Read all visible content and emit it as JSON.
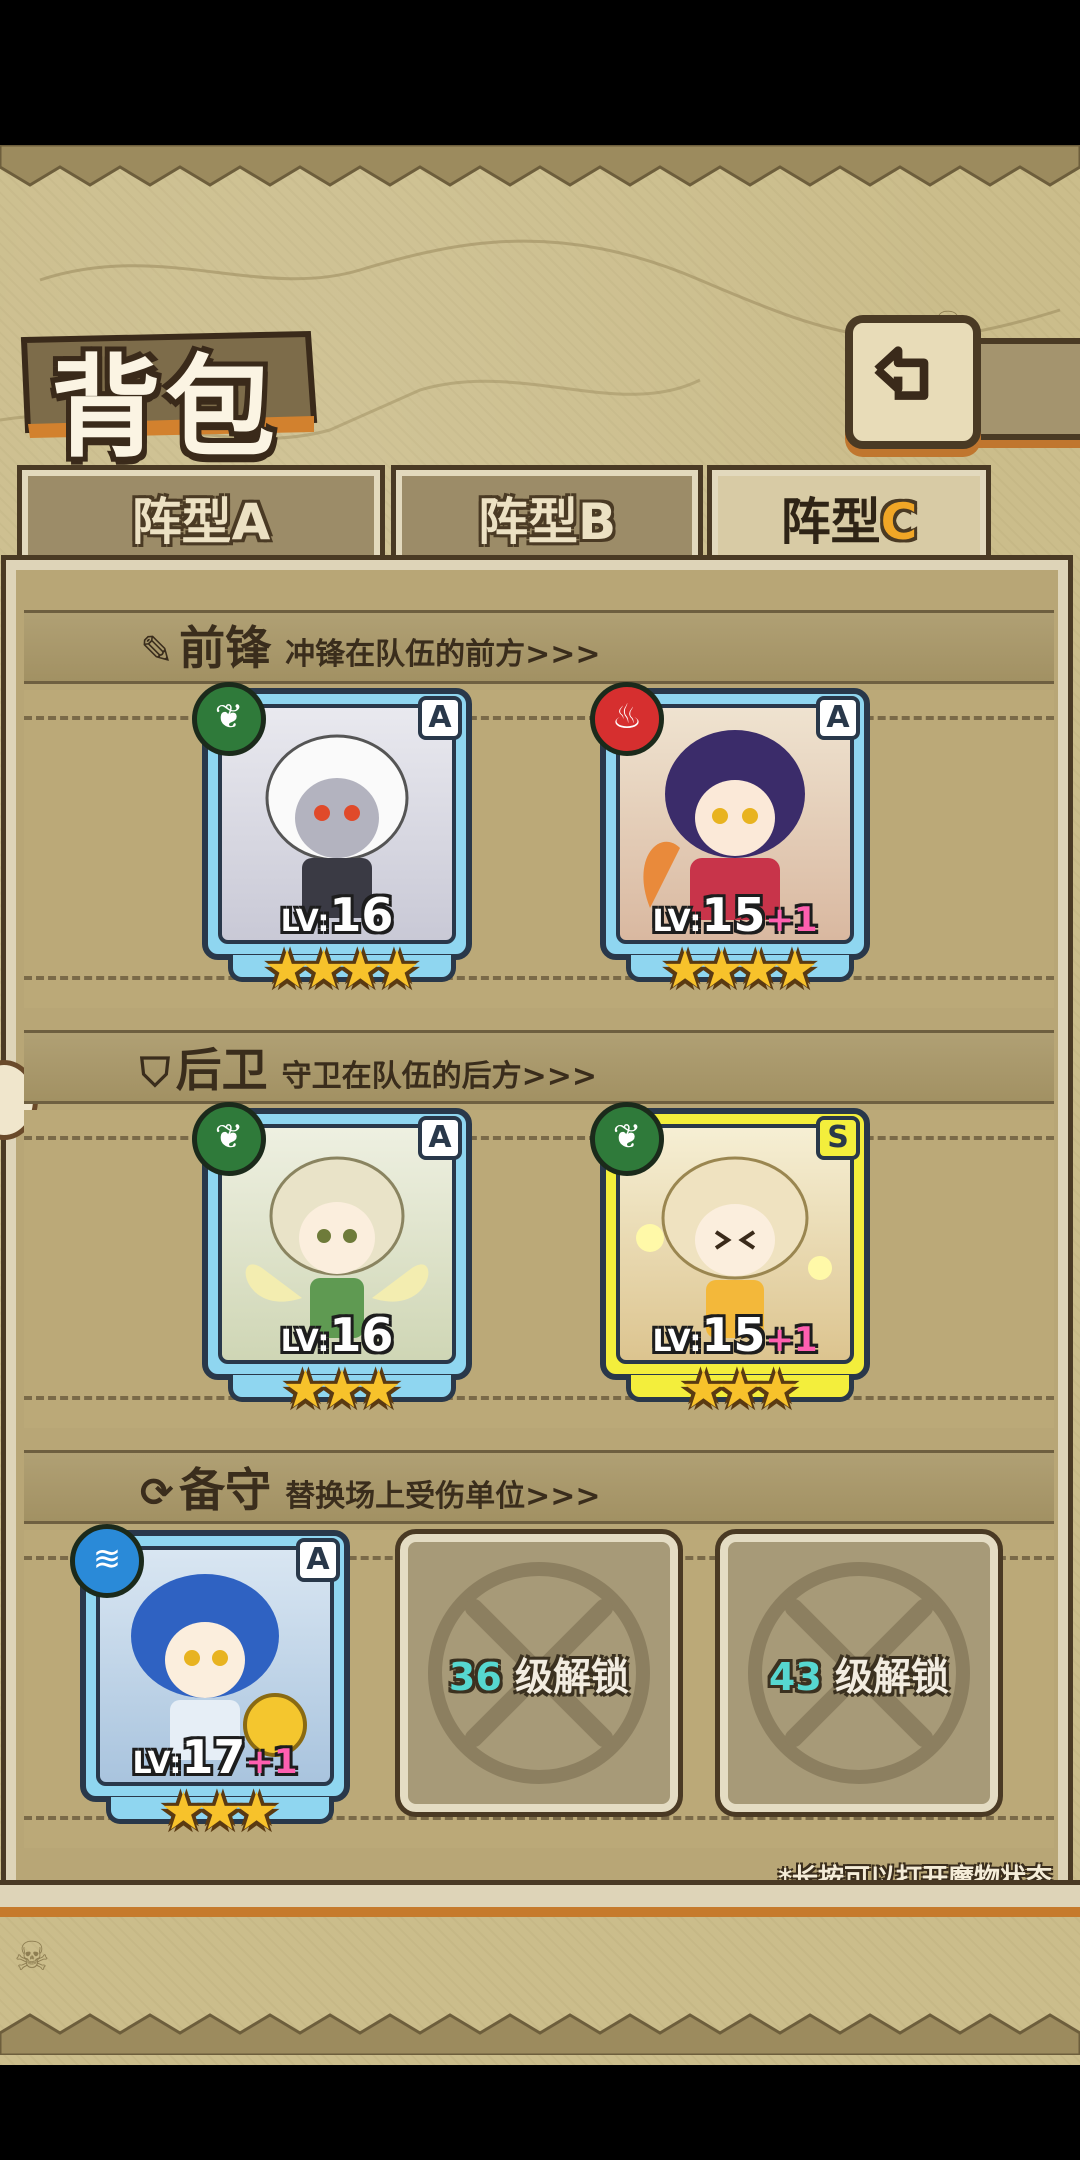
{
  "header": {
    "title": "背包"
  },
  "tabs": [
    {
      "label": "阵型",
      "suffix": "A",
      "active": false
    },
    {
      "label": "阵型",
      "suffix": "B",
      "active": false
    },
    {
      "label": "阵型",
      "suffix": "C",
      "active": true
    }
  ],
  "sections": {
    "front": {
      "title": "前锋",
      "desc": "冲锋在队伍的前方>>>",
      "icon": "sword-icon"
    },
    "rear": {
      "title": "后卫",
      "desc": "守卫在队伍的后方>>>",
      "icon": "shield-icon"
    },
    "reserve": {
      "title": "备守",
      "desc": "替换场上受伤单位>>>",
      "icon": "swap-icon"
    }
  },
  "units": {
    "front": [
      {
        "rank": "A",
        "element": "leaf-icon",
        "lv_prefix": "LV:",
        "level": "16",
        "bonus": "",
        "stars": "★★★★",
        "star_count": 4
      },
      {
        "rank": "A",
        "element": "fire-icon",
        "lv_prefix": "LV:",
        "level": "15",
        "bonus": "+1",
        "stars": "★★★★",
        "star_count": 4
      }
    ],
    "rear": [
      {
        "rank": "A",
        "element": "leaf-icon",
        "lv_prefix": "LV:",
        "level": "16",
        "bonus": "",
        "stars": "★★★",
        "star_count": 3
      },
      {
        "rank": "S",
        "element": "leaf-icon",
        "lv_prefix": "LV:",
        "level": "15",
        "bonus": "+1",
        "stars": "★★★",
        "star_count": 3
      }
    ],
    "reserve": [
      {
        "rank": "A",
        "element": "water-icon",
        "lv_prefix": "LV:",
        "level": "17",
        "bonus": "+1",
        "stars": "★★★",
        "star_count": 3
      }
    ]
  },
  "locked_slots": [
    {
      "level": "36",
      "text": "级解锁"
    },
    {
      "level": "43",
      "text": "级解锁"
    }
  ],
  "hint": "*长按可以打开魔物状态",
  "colors": {
    "parchment": "#cbbd8b",
    "card_frame_blue": "#8fd6f0",
    "card_frame_gold": "#f3ee3c",
    "active_tab_accent": "#f1a626",
    "plus_level": "#ff5fb0",
    "unlock_number": "#56d7d0"
  }
}
